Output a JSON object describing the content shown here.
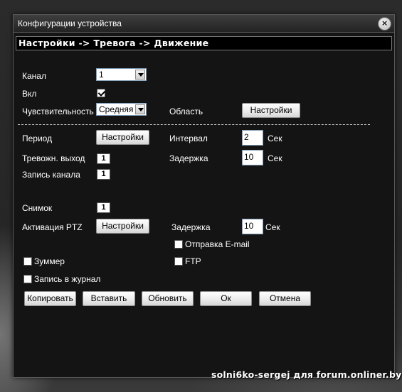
{
  "window": {
    "title": "Конфигурации устройства"
  },
  "breadcrumb": "Настройки -> Тревога -> Движение",
  "channel": {
    "label": "Канал",
    "value": "1"
  },
  "enable": {
    "label": "Вкл",
    "checked": true
  },
  "sensitivity": {
    "label": "Чувствительность",
    "value": "Средняя"
  },
  "area": {
    "label": "Область",
    "button": "Настройки"
  },
  "period": {
    "label": "Период",
    "button": "Настройки"
  },
  "interval": {
    "label": "Интервал",
    "value": "2",
    "unit": "Сек"
  },
  "alarm_output": {
    "label": "Тревожн. выход",
    "value": "1"
  },
  "delay1": {
    "label": "Задержка",
    "value": "10",
    "unit": "Сек"
  },
  "record_channel": {
    "label": "Запись канала",
    "value": "1"
  },
  "snapshot": {
    "label": "Снимок",
    "value": "1"
  },
  "ptz": {
    "label": "Активация PTZ",
    "button": "Настройки"
  },
  "delay2": {
    "label": "Задержка",
    "value": "10",
    "unit": "Сек"
  },
  "email": {
    "label": "Отправка E-mail",
    "checked": false
  },
  "buzzer": {
    "label": "Зуммер",
    "checked": false
  },
  "ftp": {
    "label": "FTP",
    "checked": false
  },
  "log": {
    "label": "Запись в журнал",
    "checked": false
  },
  "buttons": {
    "copy": "Копировать",
    "paste": "Вставить",
    "refresh": "Обновить",
    "ok": "Ок",
    "cancel": "Отмена"
  },
  "watermark": "solni6ko-sergej для forum.onliner.by",
  "icons": {
    "close": "close-icon",
    "dropdown": "chevron-down-icon",
    "check": "checkmark-icon"
  }
}
